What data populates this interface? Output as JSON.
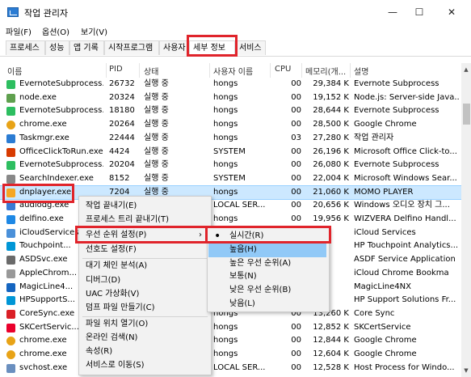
{
  "window": {
    "title": "작업 관리자",
    "min_glyph": "—",
    "max_glyph": "☐",
    "close_glyph": "✕"
  },
  "menu": [
    "파일(F)",
    "옵션(O)",
    "보기(V)"
  ],
  "tabs": [
    "프로세스",
    "성능",
    "앱 기록",
    "시작프로그램",
    "사용자",
    "세부 정보",
    "서비스"
  ],
  "columns": [
    "이름",
    "PID",
    "상태",
    "사용자 이름",
    "CPU",
    "메모리(개...",
    "설명"
  ],
  "rows": [
    {
      "name": "EvernoteSubprocess...",
      "pid": "26732",
      "status": "실행 중",
      "user": "hongs",
      "cpu": "00",
      "mem": "29,384 K",
      "desc": "Evernote Subprocess",
      "icon": "evernote",
      "color": "#2dbe60"
    },
    {
      "name": "node.exe",
      "pid": "20324",
      "status": "실행 중",
      "user": "hongs",
      "cpu": "00",
      "mem": "19,152 K",
      "desc": "Node.js: Server-side Java...",
      "icon": "node",
      "color": "#5fa04e"
    },
    {
      "name": "EvernoteSubprocess...",
      "pid": "18180",
      "status": "실행 중",
      "user": "hongs",
      "cpu": "00",
      "mem": "28,644 K",
      "desc": "Evernote Subprocess",
      "icon": "evernote",
      "color": "#2dbe60"
    },
    {
      "name": "chrome.exe",
      "pid": "20264",
      "status": "실행 중",
      "user": "hongs",
      "cpu": "00",
      "mem": "28,500 K",
      "desc": "Google Chrome",
      "icon": "chrome",
      "color": "#e8a317"
    },
    {
      "name": "Taskmgr.exe",
      "pid": "22444",
      "status": "실행 중",
      "user": "hongs",
      "cpu": "03",
      "mem": "27,280 K",
      "desc": "작업 관리자",
      "icon": "taskmgr",
      "color": "#2b7cd3"
    },
    {
      "name": "OfficeClickToRun.exe",
      "pid": "4424",
      "status": "실행 중",
      "user": "SYSTEM",
      "cpu": "00",
      "mem": "26,196 K",
      "desc": "Microsoft Office Click-to...",
      "icon": "office",
      "color": "#d83b01"
    },
    {
      "name": "EvernoteSubprocess...",
      "pid": "20204",
      "status": "실행 중",
      "user": "hongs",
      "cpu": "00",
      "mem": "26,080 K",
      "desc": "Evernote Subprocess",
      "icon": "evernote",
      "color": "#2dbe60"
    },
    {
      "name": "SearchIndexer.exe",
      "pid": "8152",
      "status": "실행 중",
      "user": "SYSTEM",
      "cpu": "00",
      "mem": "22,004 K",
      "desc": "Microsoft Windows Sear...",
      "icon": "search",
      "color": "#888888"
    },
    {
      "name": "dnplayer.exe",
      "pid": "7204",
      "status": "실행 중",
      "user": "hongs",
      "cpu": "00",
      "mem": "21,060 K",
      "desc": "MOMO PLAYER",
      "icon": "dnplayer",
      "color": "#f5a623"
    },
    {
      "name": "audiodg.exe",
      "pid": "",
      "status": "",
      "user": "LOCAL SER...",
      "cpu": "00",
      "mem": "20,656 K",
      "desc": "Windows 오디오 장치 그...",
      "icon": "audio",
      "color": "#3a7bd5"
    },
    {
      "name": "delfino.exe",
      "pid": "",
      "status": "",
      "user": "hongs",
      "cpu": "00",
      "mem": "19,956 K",
      "desc": "WIZVERA Delfino Handl...",
      "icon": "delfino",
      "color": "#1e88e5"
    },
    {
      "name": "iCloudServices...",
      "pid": "",
      "status": "",
      "user": "",
      "cpu": "",
      "mem": "",
      "desc": "iCloud Services",
      "icon": "icloud",
      "color": "#4a90d9"
    },
    {
      "name": "Touchpoint...",
      "pid": "",
      "status": "",
      "user": "",
      "cpu": "",
      "mem": "",
      "desc": "HP Touchpoint Analytics...",
      "icon": "hp",
      "color": "#0096d6"
    },
    {
      "name": "ASDSvc.exe",
      "pid": "",
      "status": "",
      "user": "",
      "cpu": "",
      "mem": "",
      "desc": "ASDF Service Application",
      "icon": "asd",
      "color": "#6a6a6a"
    },
    {
      "name": "AppleChrom...",
      "pid": "",
      "status": "",
      "user": "",
      "cpu": "",
      "mem": "",
      "desc": "iCloud Chrome Bookma",
      "icon": "apple",
      "color": "#999999"
    },
    {
      "name": "MagicLine4...",
      "pid": "",
      "status": "",
      "user": "",
      "cpu": "",
      "mem": "",
      "desc": "MagicLine4NX",
      "icon": "magic",
      "color": "#1565c0"
    },
    {
      "name": "HPSupportS...",
      "pid": "",
      "status": "",
      "user": "",
      "cpu": "",
      "mem": "",
      "desc": "HP Support Solutions Fr...",
      "icon": "hp",
      "color": "#0096d6"
    },
    {
      "name": "CoreSync.exe",
      "pid": "",
      "status": "",
      "user": "hongs",
      "cpu": "00",
      "mem": "13,260 K",
      "desc": "Core Sync",
      "icon": "coresync",
      "color": "#da1f26"
    },
    {
      "name": "SKCertServic...",
      "pid": "",
      "status": "",
      "user": "hongs",
      "cpu": "00",
      "mem": "12,852 K",
      "desc": "SKCertService",
      "icon": "skcert",
      "color": "#ea002c"
    },
    {
      "name": "chrome.exe",
      "pid": "",
      "status": "",
      "user": "hongs",
      "cpu": "00",
      "mem": "12,844 K",
      "desc": "Google Chrome",
      "icon": "chrome",
      "color": "#e8a317"
    },
    {
      "name": "chrome.exe",
      "pid": "",
      "status": "",
      "user": "hongs",
      "cpu": "00",
      "mem": "12,604 K",
      "desc": "Google Chrome",
      "icon": "chrome",
      "color": "#e8a317"
    },
    {
      "name": "svchost.exe",
      "pid": "",
      "status": "",
      "user": "LOCAL SER...",
      "cpu": "00",
      "mem": "12,528 K",
      "desc": "Host Process for Windo...",
      "icon": "svchost",
      "color": "#6a8fbf"
    }
  ],
  "context_menu": {
    "items": [
      "작업 끝내기(E)",
      "프로세스 트리 끝내기(T)",
      "우선 순위 설정(P)",
      "선호도 설정(F)",
      "대기 체인 분석(A)",
      "디버그(D)",
      "UAC 가상화(V)",
      "덤프 파일 만들기(C)",
      "파일 위치 열기(O)",
      "온라인 검색(N)",
      "속성(R)",
      "서비스로 이동(S)"
    ],
    "submenu_arrow": "›"
  },
  "submenu": {
    "items": [
      "실시간(R)",
      "높음(H)",
      "높은 우선 순위(A)",
      "보통(N)",
      "낮은 우선 순위(B)",
      "낮음(L)"
    ],
    "bullet": "•"
  },
  "colors": {
    "selection": "#cce8ff",
    "highlight_box": "#e0242b",
    "submenu_hover": "#91c9f7"
  }
}
